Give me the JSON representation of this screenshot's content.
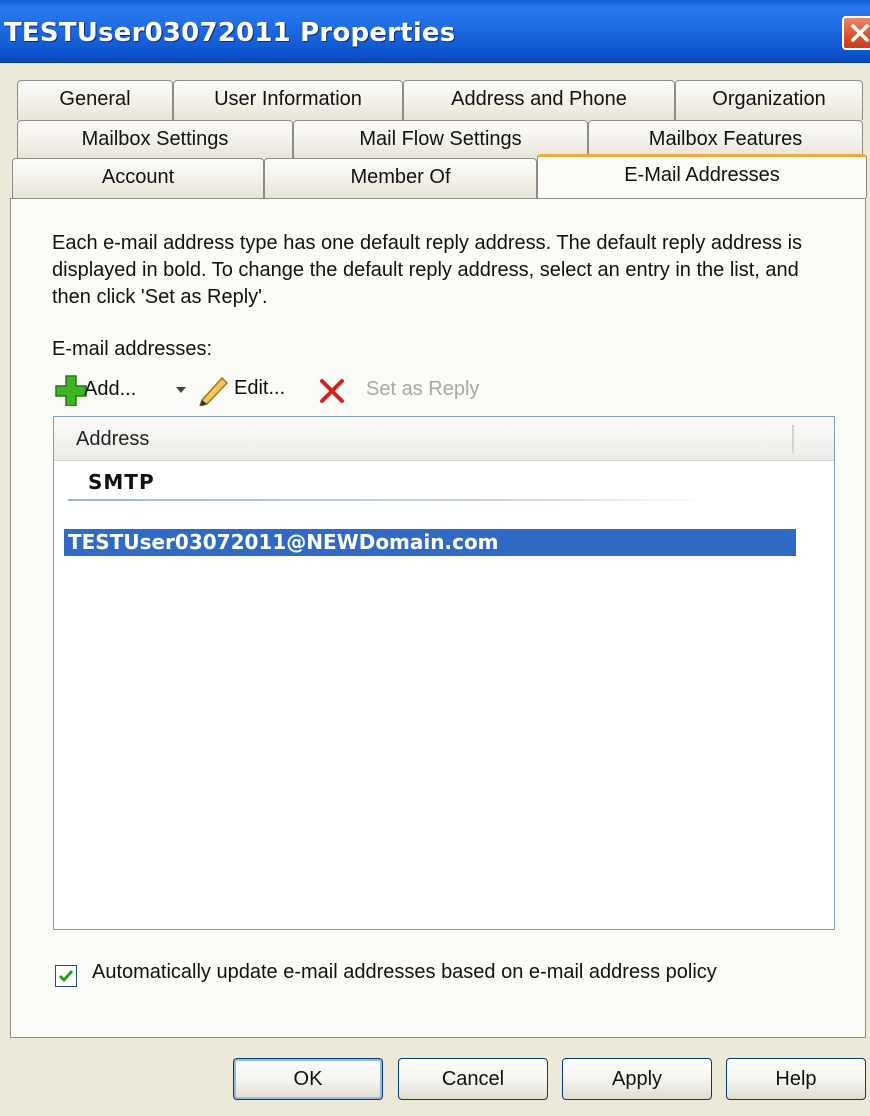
{
  "window": {
    "title": "TESTUser03072011 Properties"
  },
  "tabs": {
    "row1": [
      "General",
      "User Information",
      "Address and Phone",
      "Organization"
    ],
    "row2": [
      "Mailbox Settings",
      "Mail Flow Settings",
      "Mailbox Features"
    ],
    "row3": [
      "Account",
      "Member Of",
      "E-Mail Addresses"
    ],
    "selected": "E-Mail Addresses"
  },
  "panel": {
    "description": "Each e-mail address type has one default reply address. The default reply address is displayed in bold. To change the default reply address, select an entry in the list, and then click 'Set as Reply'.",
    "email_label": "E-mail addresses:",
    "toolbar": {
      "add_label": "Add...",
      "edit_label": "Edit...",
      "set_reply_label": "Set as Reply"
    },
    "list": {
      "column_header": "Address",
      "group": "SMTP",
      "selected_address": "TESTUser03072011@NEWDomain.com"
    },
    "auto_update": {
      "checked": true,
      "label": "Automatically update e-mail addresses based on e-mail address policy"
    }
  },
  "buttons": {
    "ok": "OK",
    "cancel": "Cancel",
    "apply": "Apply",
    "help": "Help"
  },
  "colors": {
    "title_bar": "#1c68e0",
    "selection": "#316ac5",
    "selected_tab_accent": "#f2a93c",
    "add_icon": "#3cb521",
    "delete_icon": "#d9201a"
  }
}
